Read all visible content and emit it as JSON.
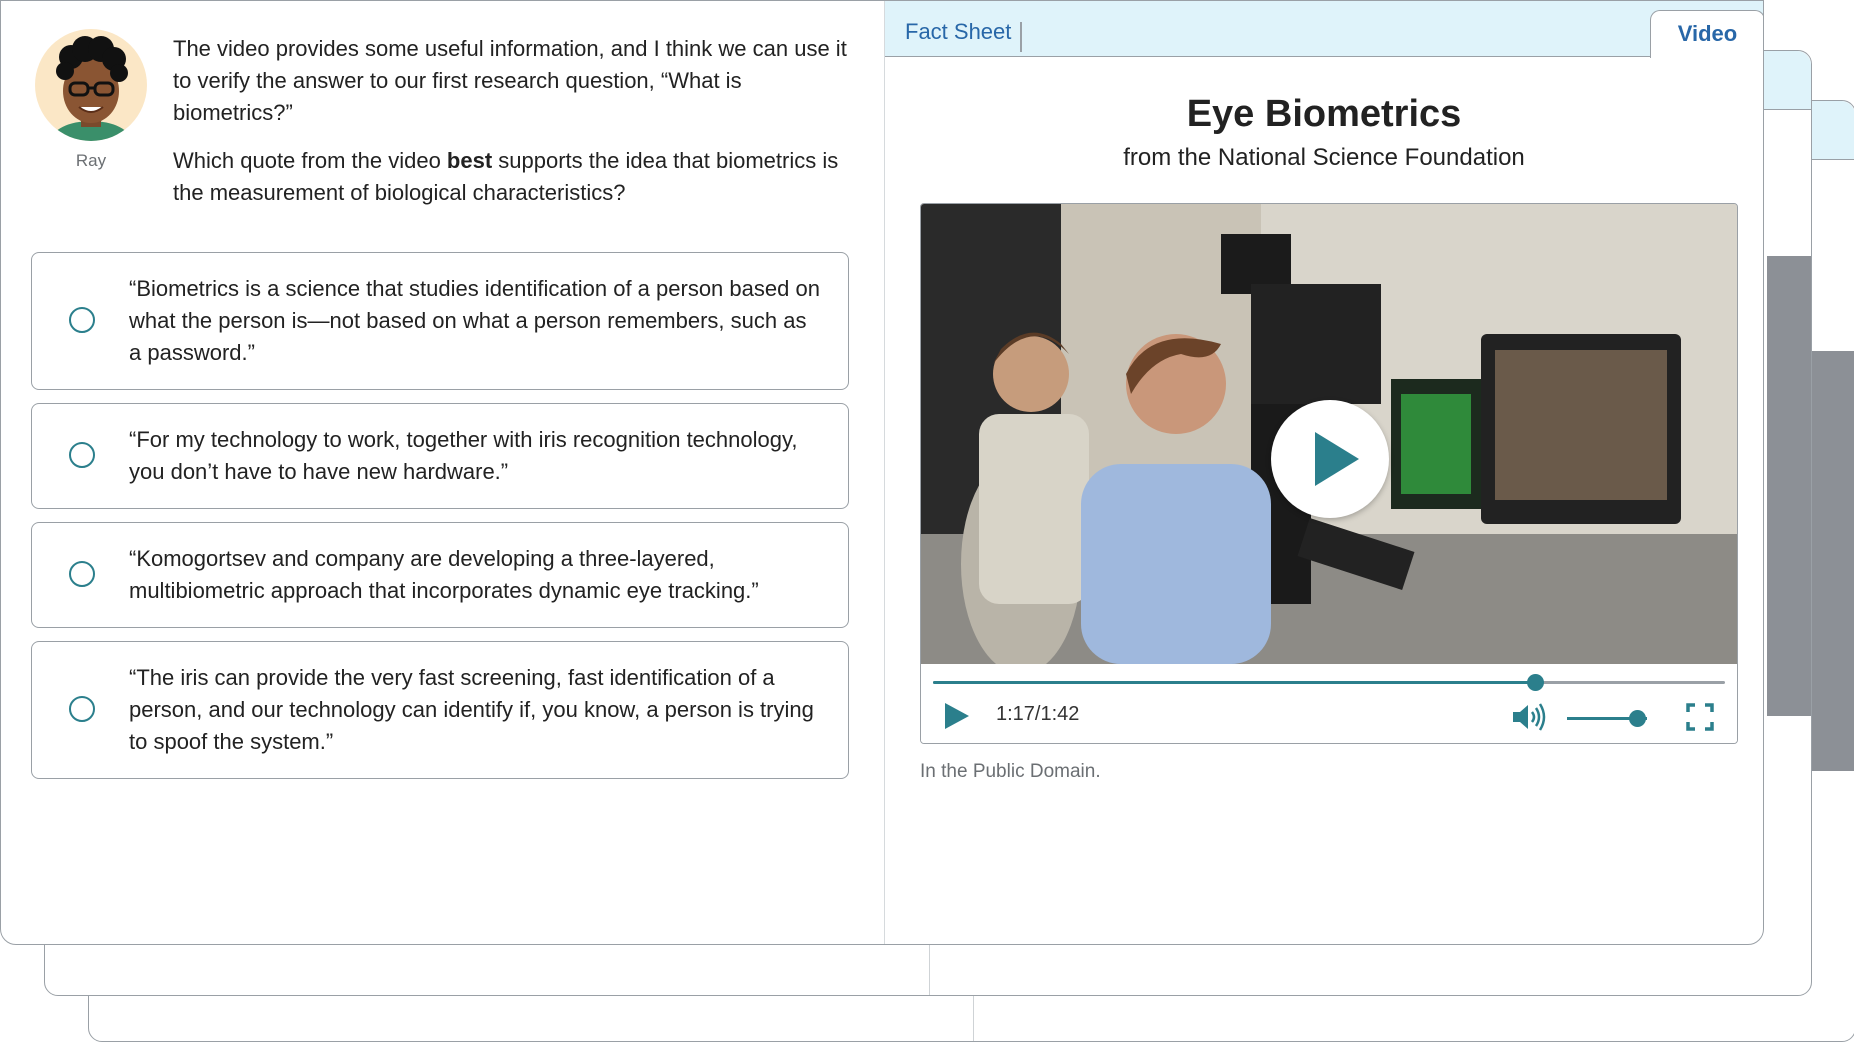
{
  "speaker": {
    "name": "Ray"
  },
  "prompt": {
    "intro": "The video provides some useful information, and I think we can use it to verify the answer to our first research question, “What is biometrics?”",
    "question_before": "Which quote from the video ",
    "question_bold": "best",
    "question_after": " supports the idea that biometrics is the measurement of biological characteristics?"
  },
  "options": [
    {
      "text": "“Biometrics is a science that studies identification of a person based on what the person is—not based on what a person remembers, such as a password.”"
    },
    {
      "text": "“For my technology to work, together with iris recognition technology, you don’t have to have new hardware.”"
    },
    {
      "text": "“Komogortsev and company are developing a three-layered, multibiometric approach that incorporates dynamic eye tracking.”"
    },
    {
      "text": "“The iris can provide the very fast screening, fast identification of a person, and our technology can identify if, you know, a person is trying to spoof the system.”"
    }
  ],
  "tabs": {
    "fact_sheet": "Fact Sheet",
    "video": "Video"
  },
  "resource": {
    "title": "Eye Biometrics",
    "subtitle": "from the National Science Foundation",
    "credit": "In the Public Domain."
  },
  "player": {
    "time": "1:17/1:42",
    "progress_fraction": 0.76,
    "volume_fraction": 0.88
  },
  "colors": {
    "accent": "#2b7f8c",
    "link": "#2867a8",
    "tab_bar": "#dff3fa"
  }
}
